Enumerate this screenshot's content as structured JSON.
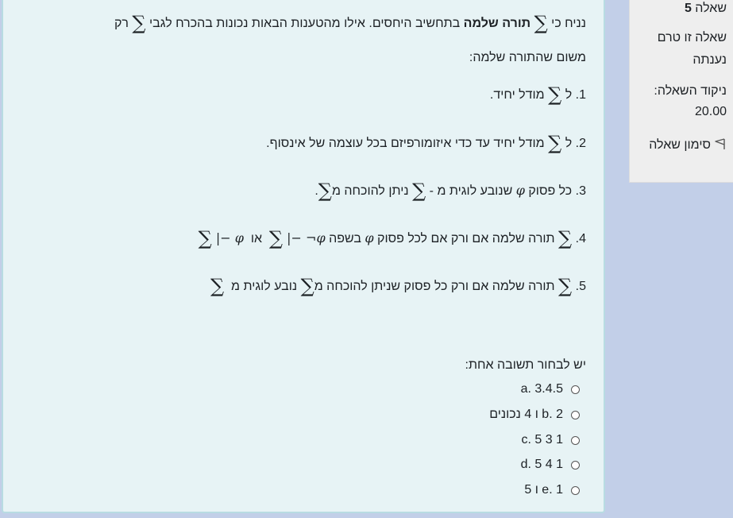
{
  "info": {
    "question_word": "שאלה",
    "question_number": "5",
    "state": "שאלה זו טרם נענתה",
    "grade_label": "ניקוד השאלה:",
    "grade_value": "20.00",
    "flag_label": "סימון שאלה"
  },
  "question": {
    "intro_1": "נניח כי",
    "intro_bold": "תורה שלמה",
    "intro_2": "בתחשיב היחסים. אילו מהטענות הבאות נכונות  בהכרח לגבי",
    "intro_3": "רק",
    "intro_line2": "משום שהתורה שלמה:",
    "s1_prefix": "1. ל",
    "s1_rest": "מודל יחיד.",
    "s2_prefix": "2. ל",
    "s2_rest": "מודל יחיד עד כדי איזומורפיזם בכל עוצמה של אינסוף.",
    "s3_a": "3.  כל פסוק",
    "s3_b": "שנובע לוגית מ -",
    "s3_c": "ניתן להוכחה מ",
    "s3_end": ".",
    "s4_a": "4.",
    "s4_b": "תורה שלמה אם ורק אם לכל פסוק",
    "s4_c": "בשפה",
    "s4_or": "או",
    "s5_a": "5.",
    "s5_b": "תורה שלמה אם ורק כל פסוק שניתן להוכחה מ",
    "s5_c": "נובע לוגית מ",
    "sigma": "∑",
    "phi": "φ",
    "neg_phi": "¬φ",
    "turnstile": "|−",
    "prompt": "יש לבחור תשובה אחת:"
  },
  "answers": [
    {
      "letter": "a.",
      "text": "3.4.5"
    },
    {
      "letter": "b.",
      "text": "2 ו 4 נכונים"
    },
    {
      "letter": "c.",
      "text": "5 3 1"
    },
    {
      "letter": "d.",
      "text": "5 4 1"
    },
    {
      "letter": "e.",
      "text": "1 ו 5"
    }
  ]
}
